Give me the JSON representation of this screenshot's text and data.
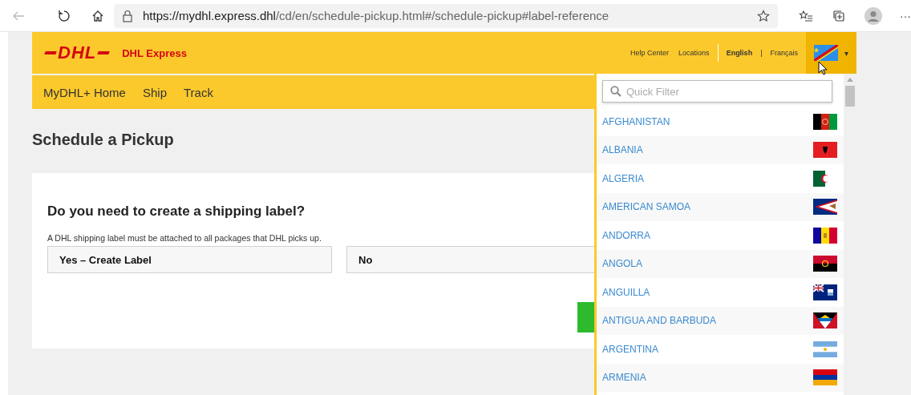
{
  "browser": {
    "url_host": "https://mydhl.express.dhl",
    "url_path": "/cd/en/schedule-pickup.html#/schedule-pickup#label-reference",
    "menu": "···"
  },
  "header": {
    "logo": "DHL",
    "brand": "DHL Express",
    "links": [
      {
        "label": "Help Center",
        "selected": false
      },
      {
        "label": "Locations",
        "selected": false
      },
      {
        "label": "English",
        "selected": true
      },
      {
        "label": "Français",
        "selected": false
      }
    ],
    "separator": "|",
    "caret": "▾"
  },
  "nav": [
    {
      "label": "MyDHL+ Home"
    },
    {
      "label": "Ship"
    },
    {
      "label": "Track"
    }
  ],
  "page_title": "Schedule a Pickup",
  "card": {
    "question": "Do you need to create a shipping label?",
    "hint": "A DHL shipping label must be attached to all packages that DHL picks up.",
    "options": [
      {
        "label": "Yes – Create Label"
      },
      {
        "label": "No"
      }
    ]
  },
  "dropdown": {
    "placeholder": "Quick Filter",
    "countries": [
      {
        "name": "AFGHANISTAN"
      },
      {
        "name": "ALBANIA"
      },
      {
        "name": "ALGERIA"
      },
      {
        "name": "AMERICAN SAMOA"
      },
      {
        "name": "ANDORRA"
      },
      {
        "name": "ANGOLA"
      },
      {
        "name": "ANGUILLA"
      },
      {
        "name": "ANTIGUA AND BARBUDA"
      },
      {
        "name": "ARGENTINA"
      },
      {
        "name": "ARMENIA"
      }
    ]
  }
}
